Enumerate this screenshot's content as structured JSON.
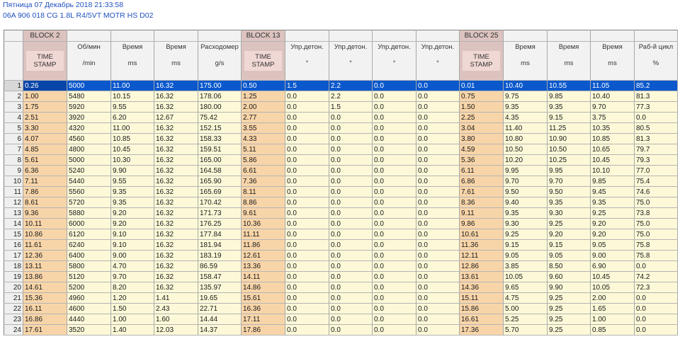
{
  "header": {
    "datetime": "Пятница 07 Декабрь 2018 21:33:58",
    "ecu": "06A 906 018 CG  1.8L R4/5VT MOTR HS D02"
  },
  "blocks": [
    "BLOCK 2",
    "BLOCK 13",
    "BLOCK 25"
  ],
  "columns": [
    {
      "label": "TIME STAMP",
      "unit": "",
      "ts": true
    },
    {
      "label": "Об/мин",
      "unit": "/min"
    },
    {
      "label": "Время",
      "unit": "ms"
    },
    {
      "label": "Время",
      "unit": "ms"
    },
    {
      "label": "Расходомер",
      "unit": "g/s"
    },
    {
      "label": "TIME STAMP",
      "unit": "",
      "ts": true
    },
    {
      "label": "Упр.детон.",
      "unit": "°"
    },
    {
      "label": "Упр.детон.",
      "unit": "°"
    },
    {
      "label": "Упр.детон.",
      "unit": "°"
    },
    {
      "label": "Упр.детон.",
      "unit": "°"
    },
    {
      "label": "TIME STAMP",
      "unit": "",
      "ts": true
    },
    {
      "label": "Время",
      "unit": "ms"
    },
    {
      "label": "Время",
      "unit": "ms"
    },
    {
      "label": "Время",
      "unit": "ms"
    },
    {
      "label": "Раб-й цикл",
      "unit": "%"
    }
  ],
  "selected_row": 0,
  "rows": [
    [
      "0.26",
      "5000",
      "11.00",
      "16.32",
      "175.00",
      "0.50",
      "1.5",
      "2.2",
      "0.0",
      "0.0",
      "0.01",
      "10.40",
      "10.55",
      "11.05",
      "85.2"
    ],
    [
      "1.00",
      "5480",
      "10.15",
      "16.32",
      "178.06",
      "1.25",
      "0.0",
      "2.2",
      "0.0",
      "0.0",
      "0.75",
      "9.75",
      "9.85",
      "10.40",
      "81.3"
    ],
    [
      "1.75",
      "5920",
      "9.55",
      "16.32",
      "180.00",
      "2.00",
      "0.0",
      "1.5",
      "0.0",
      "0.0",
      "1.50",
      "9.35",
      "9.35",
      "9.70",
      "77.3"
    ],
    [
      "2.51",
      "3920",
      "6.20",
      "12.67",
      "75.42",
      "2.77",
      "0.0",
      "0.0",
      "0.0",
      "0.0",
      "2.25",
      "4.35",
      "9.15",
      "3.75",
      "0.0"
    ],
    [
      "3.30",
      "4320",
      "11.00",
      "16.32",
      "152.15",
      "3.55",
      "0.0",
      "0.0",
      "0.0",
      "0.0",
      "3.04",
      "11.40",
      "11.25",
      "10.35",
      "80.5"
    ],
    [
      "4.07",
      "4560",
      "10.85",
      "16.32",
      "158.33",
      "4.33",
      "0.0",
      "0.0",
      "0.0",
      "0.0",
      "3.80",
      "10.80",
      "10.90",
      "10.85",
      "81.3"
    ],
    [
      "4.85",
      "4800",
      "10.45",
      "16.32",
      "159.51",
      "5.11",
      "0.0",
      "0.0",
      "0.0",
      "0.0",
      "4.59",
      "10.50",
      "10.50",
      "10.65",
      "79.7"
    ],
    [
      "5.61",
      "5000",
      "10.30",
      "16.32",
      "165.00",
      "5.86",
      "0.0",
      "0.0",
      "0.0",
      "0.0",
      "5.36",
      "10.20",
      "10.25",
      "10.45",
      "79.3"
    ],
    [
      "6.36",
      "5240",
      "9.90",
      "16.32",
      "164.58",
      "6.61",
      "0.0",
      "0.0",
      "0.0",
      "0.0",
      "6.11",
      "9.95",
      "9.95",
      "10.10",
      "77.0"
    ],
    [
      "7.11",
      "5440",
      "9.55",
      "16.32",
      "165.90",
      "7.36",
      "0.0",
      "0.0",
      "0.0",
      "0.0",
      "6.86",
      "9.70",
      "9.70",
      "9.85",
      "75.4"
    ],
    [
      "7.86",
      "5560",
      "9.35",
      "16.32",
      "165.69",
      "8.11",
      "0.0",
      "0.0",
      "0.0",
      "0.0",
      "7.61",
      "9.50",
      "9.50",
      "9.45",
      "74.6"
    ],
    [
      "8.61",
      "5720",
      "9.35",
      "16.32",
      "170.42",
      "8.86",
      "0.0",
      "0.0",
      "0.0",
      "0.0",
      "8.36",
      "9.40",
      "9.35",
      "9.35",
      "75.0"
    ],
    [
      "9.36",
      "5880",
      "9.20",
      "16.32",
      "171.73",
      "9.61",
      "0.0",
      "0.0",
      "0.0",
      "0.0",
      "9.11",
      "9.35",
      "9.30",
      "9.25",
      "73.8"
    ],
    [
      "10.11",
      "6000",
      "9.20",
      "16.32",
      "176.25",
      "10.36",
      "0.0",
      "0.0",
      "0.0",
      "0.0",
      "9.86",
      "9.30",
      "9.25",
      "9.20",
      "75.0"
    ],
    [
      "10.86",
      "6120",
      "9.10",
      "16.32",
      "177.84",
      "11.11",
      "0.0",
      "0.0",
      "0.0",
      "0.0",
      "10.61",
      "9.25",
      "9.20",
      "9.20",
      "75.0"
    ],
    [
      "11.61",
      "6240",
      "9.10",
      "16.32",
      "181.94",
      "11.86",
      "0.0",
      "0.0",
      "0.0",
      "0.0",
      "11.36",
      "9.15",
      "9.15",
      "9.05",
      "75.8"
    ],
    [
      "12.36",
      "6400",
      "9.00",
      "16.32",
      "183.19",
      "12.61",
      "0.0",
      "0.0",
      "0.0",
      "0.0",
      "12.11",
      "9.05",
      "9.05",
      "9.00",
      "75.8"
    ],
    [
      "13.11",
      "5800",
      "4.70",
      "16.32",
      "86.59",
      "13.36",
      "0.0",
      "0.0",
      "0.0",
      "0.0",
      "12.86",
      "3.85",
      "8.50",
      "6.90",
      "0.0"
    ],
    [
      "13.86",
      "5120",
      "9.70",
      "16.32",
      "158.47",
      "14.11",
      "0.0",
      "0.0",
      "0.0",
      "0.0",
      "13.61",
      "10.05",
      "9.60",
      "10.45",
      "74.2"
    ],
    [
      "14.61",
      "5200",
      "8.20",
      "16.32",
      "135.97",
      "14.86",
      "0.0",
      "0.0",
      "0.0",
      "0.0",
      "14.36",
      "9.65",
      "9.90",
      "10.05",
      "72.3"
    ],
    [
      "15.36",
      "4960",
      "1.20",
      "1.41",
      "19.65",
      "15.61",
      "0.0",
      "0.0",
      "0.0",
      "0.0",
      "15.11",
      "4.75",
      "9.25",
      "2.00",
      "0.0"
    ],
    [
      "16.11",
      "4600",
      "1.50",
      "2.43",
      "22.71",
      "16.36",
      "0.0",
      "0.0",
      "0.0",
      "0.0",
      "15.86",
      "5.00",
      "9.25",
      "1.65",
      "0.0"
    ],
    [
      "16.86",
      "4440",
      "1.00",
      "1.60",
      "14.44",
      "17.11",
      "0.0",
      "0.0",
      "0.0",
      "0.0",
      "16.61",
      "5.25",
      "9.25",
      "1.00",
      "0.0"
    ],
    [
      "17.61",
      "3520",
      "1.40",
      "12.03",
      "14.37",
      "17.86",
      "0.0",
      "0.0",
      "0.0",
      "0.0",
      "17.36",
      "5.70",
      "9.25",
      "0.85",
      "0.0"
    ]
  ]
}
